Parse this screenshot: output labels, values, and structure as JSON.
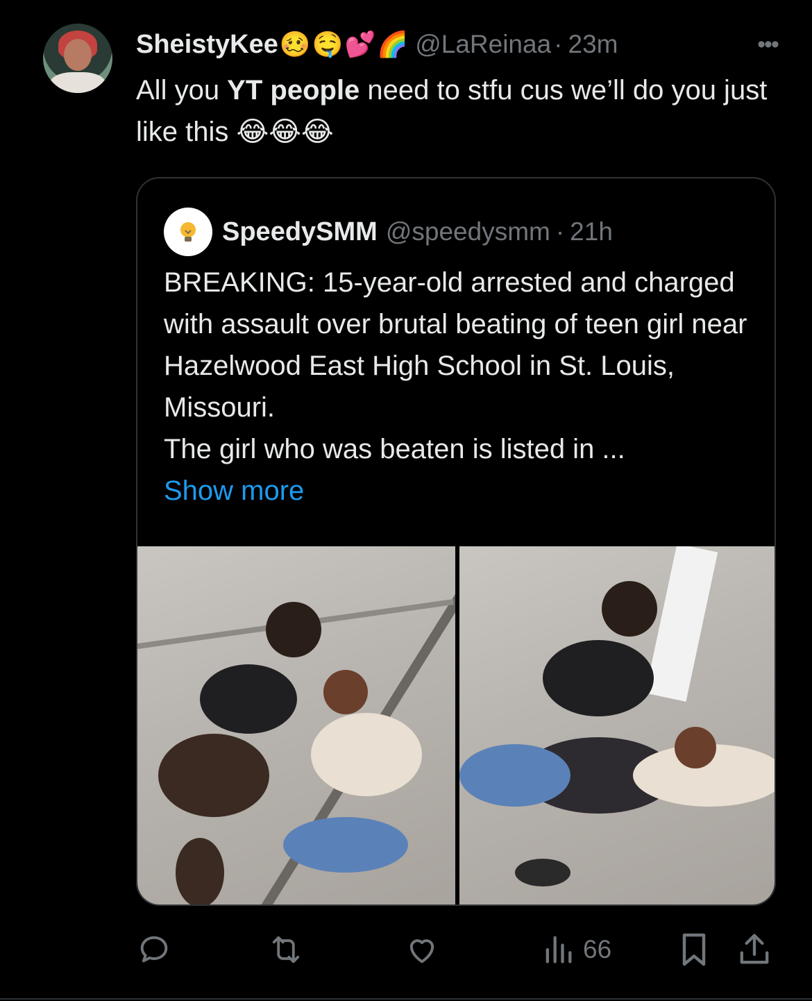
{
  "tweet": {
    "display_name": "SheistyKee",
    "name_emojis": [
      "🥴",
      "🤤",
      "💕",
      "🌈"
    ],
    "handle": "@LaReinaa",
    "time": "23m",
    "text_before_bold": "All you ",
    "text_bold": "YT people",
    "text_after_bold": " need to stfu cus we’ll do you just like this ",
    "text_emojis": "😂😂😂"
  },
  "quote": {
    "display_name": "SpeedySMM",
    "handle": "@speedysmm",
    "time": "21h",
    "text_line_1": "BREAKING: 15-year-old arrested and charged with assault over brutal beating of teen girl near Hazelwood East High School in St. Louis, Missouri.",
    "text_line_2": "The girl who was beaten is listed in ...",
    "show_more": "Show more"
  },
  "actions": {
    "views": "66"
  },
  "colors": {
    "background": "#000000",
    "text": "#e7e9ea",
    "secondary": "#71767b",
    "link": "#1d9bf0",
    "border": "#2f3336"
  }
}
